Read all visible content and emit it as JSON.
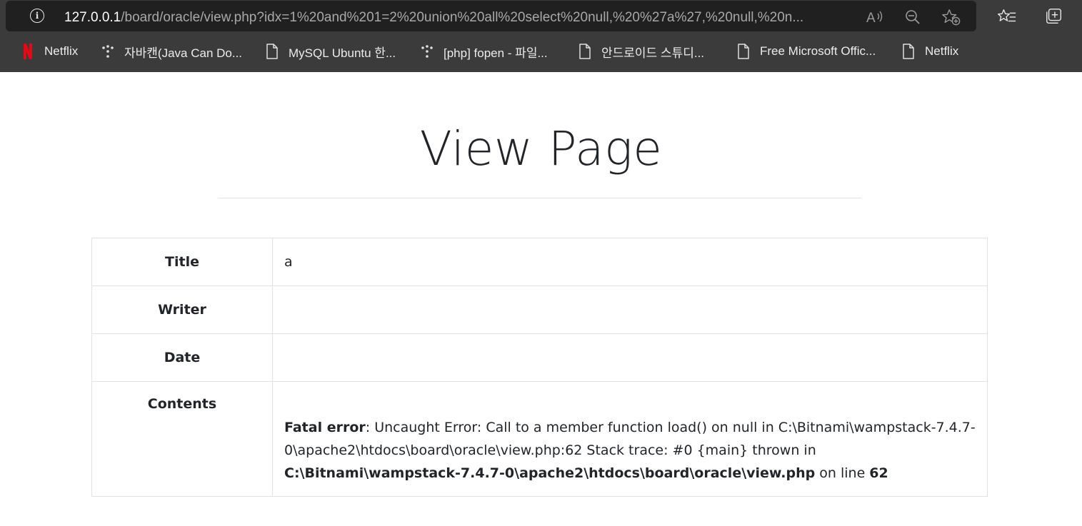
{
  "browser": {
    "url_host": "127.0.0.1",
    "url_path": "/board/oracle/view.php?idx=1%20and%201=2%20union%20all%20select%20null,%20%27a%27,%20null,%20n...",
    "bookmarks": [
      {
        "label": "Netflix",
        "icon": "netflix-icon"
      },
      {
        "label": "자바캔(Java Can Do...",
        "icon": "dots-icon"
      },
      {
        "label": "MySQL Ubuntu 한...",
        "icon": "page-icon"
      },
      {
        "label": "[php] fopen - 파일...",
        "icon": "dots-icon"
      },
      {
        "label": "안드로이드 스튜디...",
        "icon": "page-icon"
      },
      {
        "label": "Free Microsoft Offic...",
        "icon": "page-icon"
      },
      {
        "label": "Netflix",
        "icon": "page-icon"
      }
    ],
    "accent": "#e50914"
  },
  "page": {
    "heading": "View Page",
    "rows": {
      "title_label": "Title",
      "title_value": "a",
      "writer_label": "Writer",
      "writer_value": "",
      "date_label": "Date",
      "date_value": "",
      "contents_label": "Contents"
    },
    "error": {
      "prefix": "Fatal error",
      "message": ": Uncaught Error: Call to a member function load() on null in C:\\Bitnami\\wampstack-7.4.7-0\\apache2\\htdocs\\board\\oracle\\view.php:62 Stack trace: #0 {main} thrown in",
      "file": "C:\\Bitnami\\wampstack-7.4.7-0\\apache2\\htdocs\\board\\oracle\\view.php",
      "on_line": " on line ",
      "line": "62"
    }
  }
}
